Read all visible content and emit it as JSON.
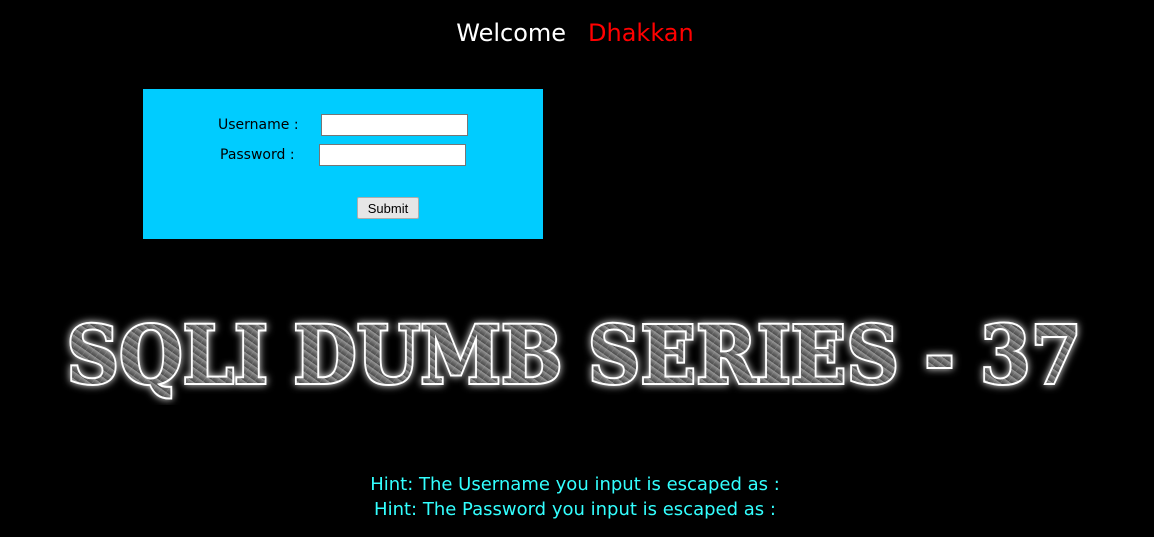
{
  "header": {
    "welcome_text": "Welcome",
    "name_text": "Dhakkan",
    "welcome_color": "#ffffff",
    "name_color": "#ff0000"
  },
  "login_form": {
    "background_color": "#00ccff",
    "username_label": "Username :",
    "password_label": "Password :",
    "username_value": "",
    "password_value": "",
    "submit_label": "Submit"
  },
  "banner": {
    "title": "SQLI DUMB SERIES - 37"
  },
  "hints": {
    "username_hint": "Hint: The Username you input is escaped as :",
    "password_hint": "Hint: The Password you input is escaped as :",
    "color": "#33ffff"
  }
}
